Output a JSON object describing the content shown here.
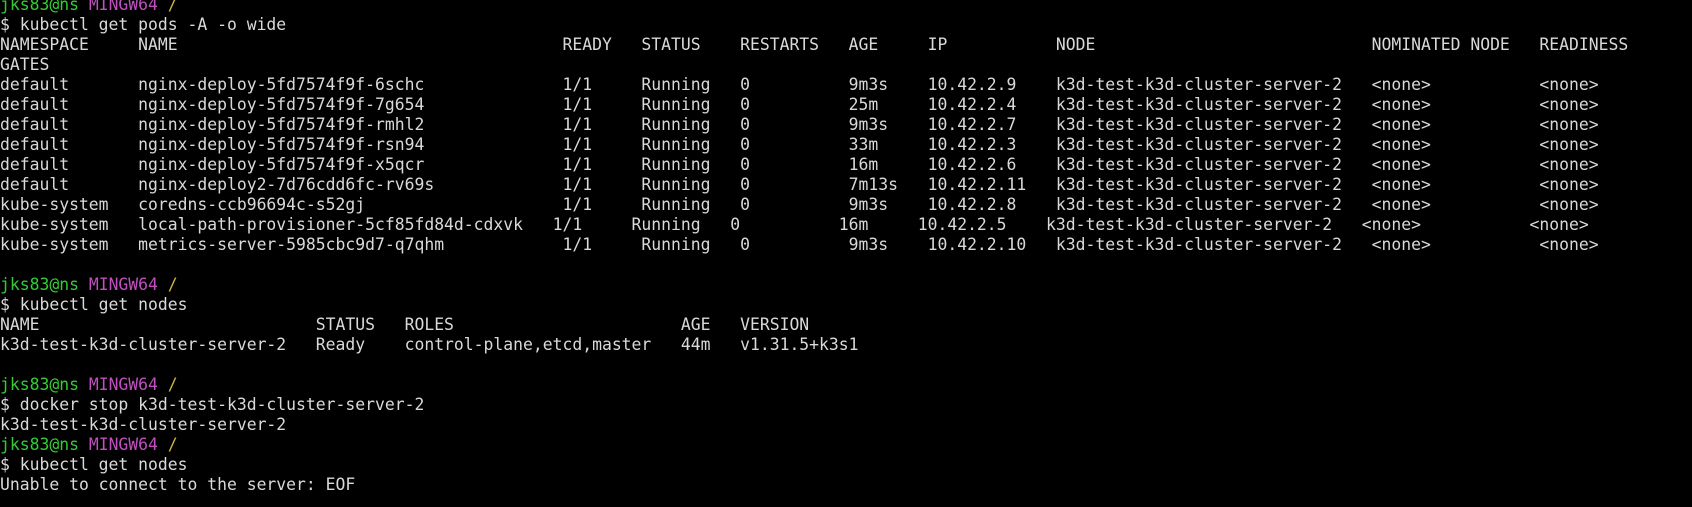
{
  "terminal": {
    "colors": {
      "background": "#000000",
      "text": "#d9d9d9",
      "prompt_user": "#33cc33",
      "prompt_env": "#c050c0",
      "prompt_path": "#d2b43c"
    },
    "lines": [
      {
        "type": "prompt",
        "user": "jks83@ns",
        "env": "MINGW64",
        "path": "/"
      },
      {
        "type": "text",
        "text": "$ kubectl get pods -A -o wide"
      },
      {
        "type": "text",
        "text": "NAMESPACE     NAME                                       READY   STATUS    RESTARTS   AGE     IP           NODE                            NOMINATED NODE   READINESS"
      },
      {
        "type": "text",
        "text": "GATES"
      },
      {
        "type": "text",
        "text": "default       nginx-deploy-5fd7574f9f-6schc              1/1     Running   0          9m3s    10.42.2.9    k3d-test-k3d-cluster-server-2   <none>           <none>"
      },
      {
        "type": "text",
        "text": "default       nginx-deploy-5fd7574f9f-7g654              1/1     Running   0          25m     10.42.2.4    k3d-test-k3d-cluster-server-2   <none>           <none>"
      },
      {
        "type": "text",
        "text": "default       nginx-deploy-5fd7574f9f-rmhl2              1/1     Running   0          9m3s    10.42.2.7    k3d-test-k3d-cluster-server-2   <none>           <none>"
      },
      {
        "type": "text",
        "text": "default       nginx-deploy-5fd7574f9f-rsn94              1/1     Running   0          33m     10.42.2.3    k3d-test-k3d-cluster-server-2   <none>           <none>"
      },
      {
        "type": "text",
        "text": "default       nginx-deploy-5fd7574f9f-x5qcr              1/1     Running   0          16m     10.42.2.6    k3d-test-k3d-cluster-server-2   <none>           <none>"
      },
      {
        "type": "text",
        "text": "default       nginx-deploy2-7d76cdd6fc-rv69s             1/1     Running   0          7m13s   10.42.2.11   k3d-test-k3d-cluster-server-2   <none>           <none>"
      },
      {
        "type": "text",
        "text": "kube-system   coredns-ccb96694c-s52gj                    1/1     Running   0          9m3s    10.42.2.8    k3d-test-k3d-cluster-server-2   <none>           <none>"
      },
      {
        "type": "text",
        "text": "kube-system   local-path-provisioner-5cf85fd84d-cdxvk   1/1     Running   0          16m     10.42.2.5    k3d-test-k3d-cluster-server-2   <none>           <none>"
      },
      {
        "type": "text",
        "text": "kube-system   metrics-server-5985cbc9d7-q7qhm            1/1     Running   0          9m3s    10.42.2.10   k3d-test-k3d-cluster-server-2   <none>           <none>"
      },
      {
        "type": "text",
        "text": ""
      },
      {
        "type": "prompt",
        "user": "jks83@ns",
        "env": "MINGW64",
        "path": "/"
      },
      {
        "type": "text",
        "text": "$ kubectl get nodes"
      },
      {
        "type": "text",
        "text": "NAME                            STATUS   ROLES                       AGE   VERSION"
      },
      {
        "type": "text",
        "text": "k3d-test-k3d-cluster-server-2   Ready    control-plane,etcd,master   44m   v1.31.5+k3s1"
      },
      {
        "type": "text",
        "text": ""
      },
      {
        "type": "prompt",
        "user": "jks83@ns",
        "env": "MINGW64",
        "path": "/"
      },
      {
        "type": "text",
        "text": "$ docker stop k3d-test-k3d-cluster-server-2"
      },
      {
        "type": "text",
        "text": "k3d-test-k3d-cluster-server-2"
      },
      {
        "type": "prompt",
        "user": "jks83@ns",
        "env": "MINGW64",
        "path": "/"
      },
      {
        "type": "text",
        "text": "$ kubectl get nodes"
      },
      {
        "type": "text",
        "text": "Unable to connect to the server: EOF"
      }
    ]
  }
}
